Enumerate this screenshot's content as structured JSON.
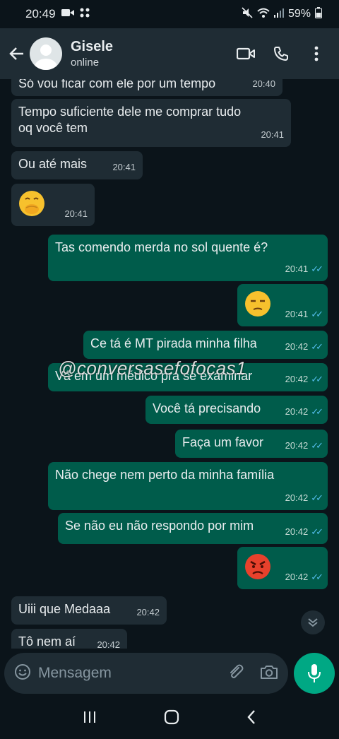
{
  "status_bar": {
    "time": "20:49",
    "battery": "59%"
  },
  "header": {
    "name": "Gisele",
    "status": "online"
  },
  "messages": [
    {
      "dir": "in",
      "text": "Só vou ficar com ele por um tempo",
      "time": "20:40"
    },
    {
      "dir": "in",
      "text": "Tempo suficiente dele me comprar tudo oq você tem",
      "time": "20:41"
    },
    {
      "dir": "in",
      "text": "Ou até mais",
      "time": "20:41"
    },
    {
      "dir": "in",
      "emoji": "hand-over-mouth-emoji",
      "time": "20:41"
    },
    {
      "dir": "out",
      "text": "Tas comendo merda no sol quente é?",
      "time": "20:41"
    },
    {
      "dir": "out",
      "emoji": "unamused-emoji",
      "time": "20:41"
    },
    {
      "dir": "out",
      "text": "Ce tá é MT pirada minha filha",
      "time": "20:42"
    },
    {
      "dir": "out",
      "text": "Vá em um médico pra se examinar",
      "time": "20:42"
    },
    {
      "dir": "out",
      "text": "Você tá precisando",
      "time": "20:42"
    },
    {
      "dir": "out",
      "text": "Faça um favor",
      "time": "20:42"
    },
    {
      "dir": "out",
      "text": "Não chege nem perto da minha família",
      "time": "20:42"
    },
    {
      "dir": "out",
      "text": "Se não eu não respondo por mim",
      "time": "20:42"
    },
    {
      "dir": "out",
      "emoji": "angry-face-emoji",
      "time": "20:42"
    },
    {
      "dir": "in",
      "text": "Uiii que Medaaa",
      "time": "20:42"
    },
    {
      "dir": "in",
      "text": "Tô nem aí",
      "time": "20:42"
    }
  ],
  "watermark": "@conversasefofocas1",
  "composer": {
    "placeholder": "Mensagem"
  },
  "colors": {
    "background": "#0b141a",
    "incoming_bubble": "#1f2c34",
    "outgoing_bubble": "#005c4b",
    "read_ticks": "#53bdeb",
    "accent": "#00a884"
  }
}
